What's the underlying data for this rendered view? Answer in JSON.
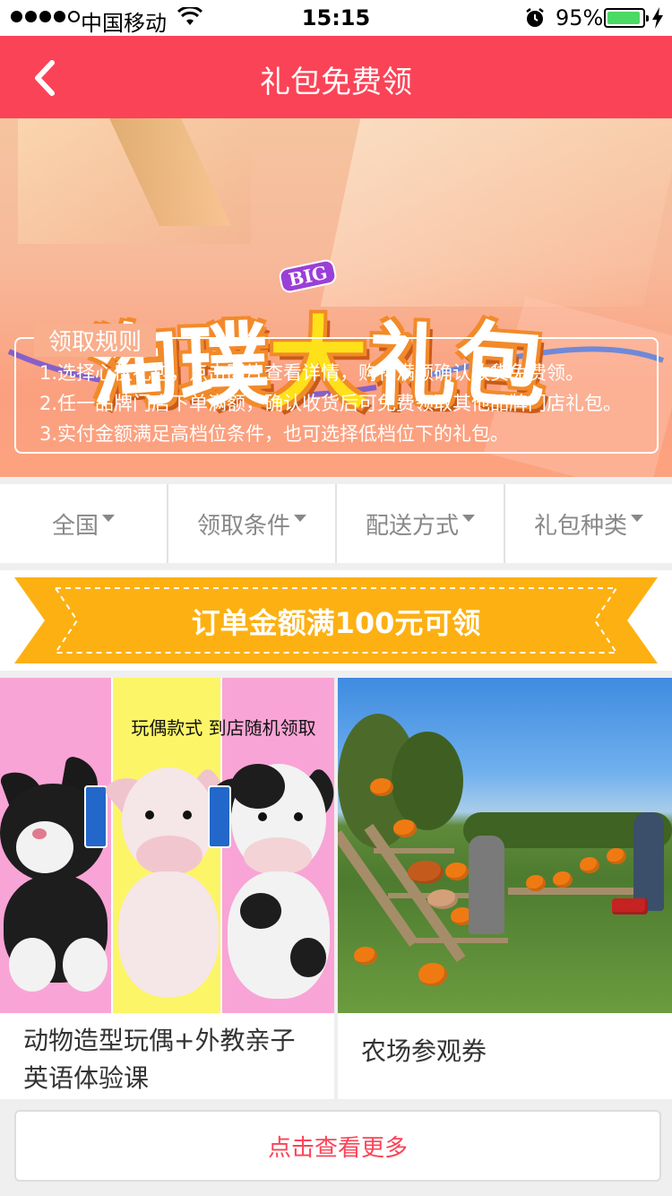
{
  "status_bar": {
    "carrier": "中国移动",
    "time": "15:15",
    "battery_percent": "95%",
    "battery_level": 0.95,
    "icons": [
      "signal-icon",
      "wifi-icon",
      "alarm-icon",
      "battery-icon",
      "charging-icon"
    ]
  },
  "nav": {
    "title": "礼包免费领",
    "back_icon": "chevron-left-icon",
    "color": "#fb4357"
  },
  "banner": {
    "badge": "BIG",
    "logo_chars": [
      "淘",
      "璞",
      "大",
      "礼",
      "包"
    ],
    "rules_title": "领取规则",
    "rules": [
      "1.选择心仪礼包，点击图片查看详情，购物满额确认收货免费领。",
      "2.任一品牌门店下单满额，确认收货后可免费领取其他品牌门店礼包。",
      "3.实付金额满足高档位条件，也可选择低档位下的礼包。"
    ]
  },
  "filters": [
    {
      "label": "全国",
      "icon": "caret-down-icon"
    },
    {
      "label": "领取条件",
      "icon": "caret-down-icon"
    },
    {
      "label": "配送方式",
      "icon": "caret-down-icon"
    },
    {
      "label": "礼包种类",
      "icon": "caret-down-icon"
    }
  ],
  "promo": {
    "text": "订单金额满100元可领",
    "color": "#fdb012"
  },
  "gifts": [
    {
      "name": "动物造型玩偶+外教亲子英语体验课",
      "image_note": "玩偶款式 到店随机领取"
    },
    {
      "name": "农场参观券"
    }
  ],
  "more_button": "点击查看更多"
}
